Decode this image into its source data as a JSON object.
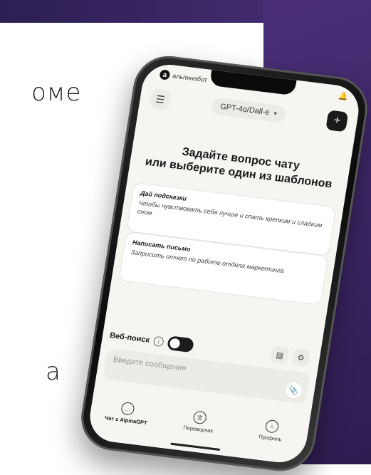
{
  "background": {
    "text_top": "оме",
    "text_bottom": "а",
    "accent_color": "#3a2563"
  },
  "statusbar": {
    "logo": "а",
    "brand": "альпинабот",
    "bell_icon": "bell-icon"
  },
  "header": {
    "menu_icon": "menu-icon",
    "model": "GPT-4o/Dall-e",
    "new_chat_icon": "plus-icon"
  },
  "main": {
    "prompt_line1": "Задайте вопрос чату",
    "prompt_line2": "или выберите один из шаблонов",
    "templates": [
      {
        "title": "Дай подсказки",
        "text": "Чтобы чувствовать себя лучше и спать крепким и сладким сном"
      },
      {
        "title": "Написать письмо",
        "text": "Запросить отчет по работе отдела маркетинга"
      }
    ]
  },
  "composer": {
    "web_search_label": "Веб-поиск",
    "web_search_enabled": true,
    "input_placeholder": "Введите сообщение",
    "input_value": "",
    "tool1_icon": "notes-icon",
    "tool2_icon": "gear-icon",
    "attach_icon": "paperclip-icon"
  },
  "tabbar": {
    "items": [
      {
        "label": "Чат с AlpinaGPT",
        "icon": "chat-icon"
      },
      {
        "label": "Переводчик",
        "icon": "translate-icon"
      },
      {
        "label": "Профиль",
        "icon": "profile-icon"
      }
    ]
  }
}
